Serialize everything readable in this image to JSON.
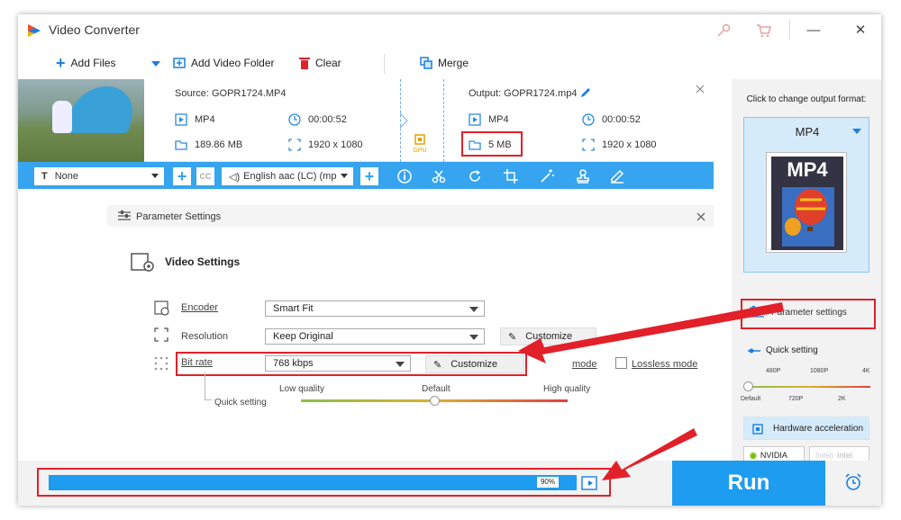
{
  "app": {
    "title": "Video Converter"
  },
  "toolbar": {
    "add_files": "Add Files",
    "add_folder": "Add Video Folder",
    "clear": "Clear",
    "merge": "Merge"
  },
  "source": {
    "label": "Source: GOPR1724.MP4",
    "format": "MP4",
    "duration": "00:00:52",
    "size": "189.86 MB",
    "resolution": "1920 x 1080"
  },
  "output": {
    "label": "Output: GOPR1724.mp4",
    "format": "MP4",
    "duration": "00:00:52",
    "size": "5 MB",
    "resolution": "1920 x 1080"
  },
  "gpu_label": "GPU",
  "editbar": {
    "subtitle": "None",
    "audio": "English aac (LC) (mp"
  },
  "param": {
    "title": "Parameter Settings",
    "section": "Video Settings",
    "encoder_label": "Encoder",
    "encoder_value": "Smart Fit",
    "resolution_label": "Resolution",
    "resolution_value": "Keep Original",
    "resolution_btn": "Customize",
    "bitrate_label": "Bit rate",
    "bitrate_value": "768 kbps",
    "bitrate_btn": "Customize",
    "partial_mode": "mode",
    "lossless": "Lossless mode",
    "low": "Low quality",
    "default": "Default",
    "high": "High quality",
    "quick": "Quick setting"
  },
  "right": {
    "prompt": "Click to change output format:",
    "format": "MP4",
    "format_image_text": "MP4",
    "param_btn": "Parameter settings",
    "quick": "Quick setting",
    "ticks_top": [
      "480P",
      "1080P",
      "4K"
    ],
    "ticks_bottom": [
      "Default",
      "720P",
      "2K"
    ],
    "hw": "Hardware acceleration",
    "nvidia": "NVIDIA",
    "intel": "Intel"
  },
  "progress": {
    "value": 0.9,
    "label": "90%"
  },
  "run_label": "Run",
  "colors": {
    "accent": "#1e9cf0",
    "highlight": "#e2202a"
  }
}
